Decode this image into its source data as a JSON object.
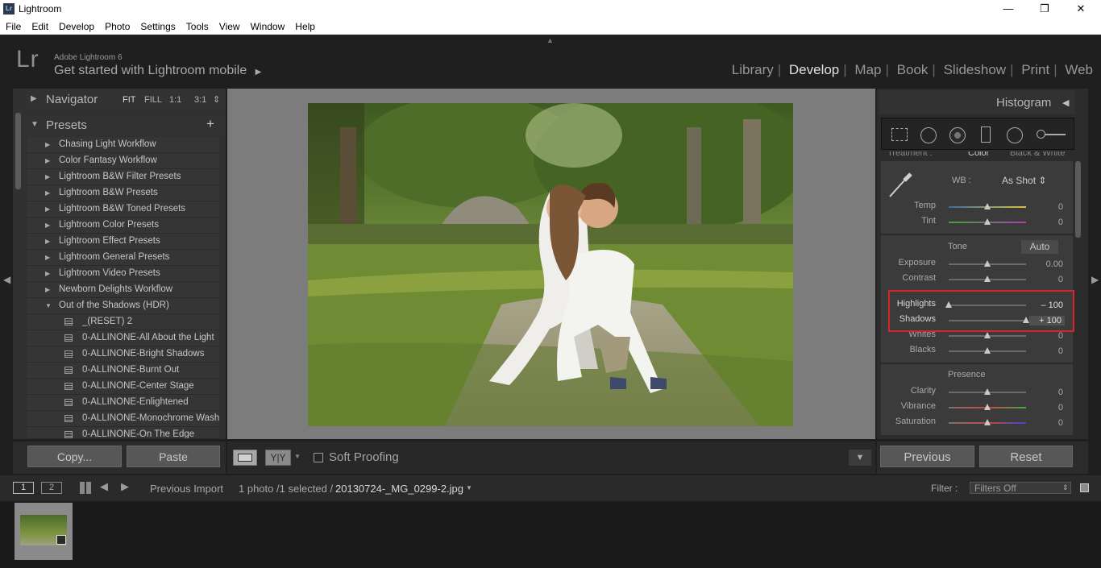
{
  "window": {
    "title": "Lightroom",
    "app_icon": "Lr",
    "minimize": "—",
    "restore": "❐",
    "close": "✕"
  },
  "menu": [
    "File",
    "Edit",
    "Develop",
    "Photo",
    "Settings",
    "Tools",
    "View",
    "Window",
    "Help"
  ],
  "header": {
    "logo": "Lr",
    "product": "Adobe Lightroom 6",
    "mobile_prompt": "Get started with Lightroom mobile",
    "mobile_arrow": "▶",
    "modules": [
      "Library",
      "Develop",
      "Map",
      "Book",
      "Slideshow",
      "Print",
      "Web"
    ],
    "active_module": "Develop"
  },
  "left": {
    "navigator": {
      "title": "Navigator",
      "zoom": [
        "FIT",
        "FILL",
        "1:1",
        "3:1"
      ],
      "zoom_arrow": "⇕"
    },
    "presets": {
      "title": "Presets",
      "add_label": "+",
      "folders": [
        "Chasing Light Workflow",
        "Color Fantasy Workflow",
        "Lightroom B&W Filter Presets",
        "Lightroom B&W Presets",
        "Lightroom B&W Toned Presets",
        "Lightroom Color Presets",
        "Lightroom Effect Presets",
        "Lightroom General Presets",
        "Lightroom Video Presets",
        "Newborn Delights Workflow"
      ],
      "open_folder": "Out of the Shadows (HDR)",
      "items": [
        "_(RESET) 2",
        "0-ALLINONE-All About the Light",
        "0-ALLINONE-Bright Shadows",
        "0-ALLINONE-Burnt Out",
        "0-ALLINONE-Center Stage",
        "0-ALLINONE-Enlightened",
        "0-ALLINONE-Monochrome Wash",
        "0-ALLINONE-On The Edge"
      ]
    },
    "copy_label": "Copy...",
    "paste_label": "Paste"
  },
  "toolbar": {
    "soft_proofing": "Soft Proofing",
    "compare_label": "Y|Y"
  },
  "right": {
    "histogram_title": "Histogram",
    "histogram_arrow": "◀",
    "basic": {
      "treatment_label": "Treatment :",
      "treatment_options": [
        "Color",
        "Black & White"
      ],
      "wb_label": "WB :",
      "wb_value": "As Shot ⇕",
      "temp": {
        "label": "Temp",
        "value": "0"
      },
      "tint": {
        "label": "Tint",
        "value": "0"
      },
      "tone_label": "Tone",
      "auto_label": "Auto",
      "exposure": {
        "label": "Exposure",
        "value": "0.00"
      },
      "contrast": {
        "label": "Contrast",
        "value": "0"
      },
      "highlights": {
        "label": "Highlights",
        "value": "– 100"
      },
      "shadows": {
        "label": "Shadows",
        "value": "+ 100"
      },
      "whites": {
        "label": "Whites",
        "value": "0"
      },
      "blacks": {
        "label": "Blacks",
        "value": "0"
      },
      "presence_label": "Presence",
      "clarity": {
        "label": "Clarity",
        "value": "0"
      },
      "vibrance": {
        "label": "Vibrance",
        "value": "0"
      },
      "saturation": {
        "label": "Saturation",
        "value": "0"
      }
    },
    "previous_label": "Previous",
    "reset_label": "Reset"
  },
  "filmstrip": {
    "screen1": "1",
    "screen2": "2",
    "source": "Previous Import",
    "count": "1 photo /1 selected /",
    "filename": "20130724-_MG_0299-2.jpg",
    "filter_label": "Filter :",
    "filter_value": "Filters Off"
  },
  "colors": {
    "highlight_box": "#d6262c",
    "panel_bg": "#2c2c2c",
    "center_bg": "#7c7c7c"
  }
}
